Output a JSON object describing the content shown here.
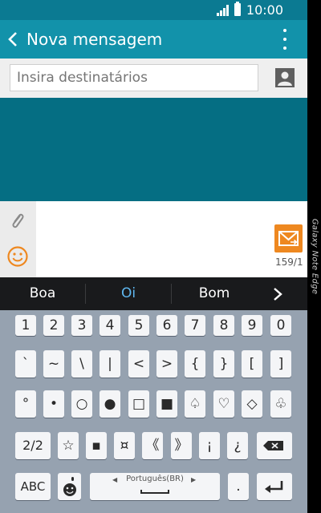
{
  "status_bar": {
    "time": "10:00"
  },
  "app_bar": {
    "title": "Nova mensagem"
  },
  "recipients": {
    "placeholder": "Insira destinatários"
  },
  "compose": {
    "char_counter": "159/1"
  },
  "suggestions": {
    "items": [
      "Boa",
      "Oi",
      "Bom"
    ],
    "highlight_color": "#5fb8f0"
  },
  "keyboard": {
    "row1": [
      "1",
      "2",
      "3",
      "4",
      "5",
      "6",
      "7",
      "8",
      "9",
      "0"
    ],
    "row2": [
      "`",
      "~",
      "\\",
      "|",
      "<",
      ">",
      "{",
      "}",
      "[",
      "]"
    ],
    "row3": [
      "°",
      "•",
      "○",
      "●",
      "□",
      "■",
      "♤",
      "♡",
      "◇",
      "♧"
    ],
    "row4": {
      "page_key": "2/2",
      "symbols": [
        "☆",
        "▪",
        "¤",
        "《",
        "》",
        "¡",
        "¿"
      ]
    },
    "row5": {
      "abc_key": "ABC",
      "space_label": "Português(BR)",
      "punct_key": "."
    }
  },
  "device": {
    "edge_label": "Galaxy Note Edge"
  },
  "colors": {
    "status_bar": "#0b7a92",
    "app_bar": "#1292aa",
    "conversation": "#056e83",
    "send": "#ee8820",
    "keyboard": "#96a2b0"
  }
}
